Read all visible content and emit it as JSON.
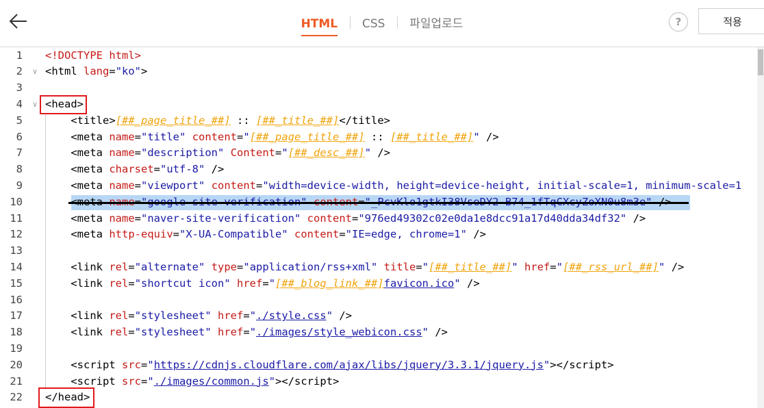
{
  "header": {
    "tabs": [
      "HTML",
      "CSS",
      "파일업로드"
    ],
    "active_tab": "HTML",
    "help_label": "?",
    "apply_label": "적용"
  },
  "editor": {
    "highlighted_line": 10,
    "redacted_line": 10,
    "lines": [
      {
        "n": "1",
        "fold": false,
        "tokens": [
          [
            "doctype",
            "<!DOCTYPE html>"
          ]
        ]
      },
      {
        "n": "2",
        "fold": true,
        "tokens": [
          [
            "punct",
            "<"
          ],
          [
            "tagname",
            "html"
          ],
          [
            "punct",
            " "
          ],
          [
            "attr",
            "lang"
          ],
          [
            "punct",
            "="
          ],
          [
            "str",
            "\"ko\""
          ],
          [
            "punct",
            ">"
          ]
        ]
      },
      {
        "n": "3",
        "fold": false,
        "tokens": []
      },
      {
        "n": "4",
        "fold": true,
        "tokens": [
          [
            "punct",
            "<"
          ],
          [
            "tagname",
            "head"
          ],
          [
            "punct",
            ">"
          ]
        ]
      },
      {
        "n": "5",
        "fold": false,
        "tokens": [
          [
            "punct",
            "    <"
          ],
          [
            "tagname",
            "title"
          ],
          [
            "punct",
            ">"
          ],
          [
            "tpl",
            "[##_page_title_##]"
          ],
          [
            "punct",
            " :: "
          ],
          [
            "tpl",
            "[##_title_##]"
          ],
          [
            "punct",
            "</"
          ],
          [
            "tagname",
            "title"
          ],
          [
            "punct",
            ">"
          ]
        ]
      },
      {
        "n": "6",
        "fold": false,
        "tokens": [
          [
            "punct",
            "    <"
          ],
          [
            "tagname",
            "meta"
          ],
          [
            "punct",
            " "
          ],
          [
            "attr",
            "name"
          ],
          [
            "punct",
            "="
          ],
          [
            "str",
            "\"title\""
          ],
          [
            "punct",
            " "
          ],
          [
            "attr",
            "content"
          ],
          [
            "punct",
            "="
          ],
          [
            "str",
            "\""
          ],
          [
            "tpl",
            "[##_page_title_##]"
          ],
          [
            "punct",
            " :: "
          ],
          [
            "tpl",
            "[##_title_##]"
          ],
          [
            "str",
            "\""
          ],
          [
            "punct",
            " />"
          ]
        ]
      },
      {
        "n": "7",
        "fold": false,
        "tokens": [
          [
            "punct",
            "    <"
          ],
          [
            "tagname",
            "meta"
          ],
          [
            "punct",
            " "
          ],
          [
            "attr",
            "name"
          ],
          [
            "punct",
            "="
          ],
          [
            "str",
            "\"description\""
          ],
          [
            "punct",
            " "
          ],
          [
            "attr",
            "Content"
          ],
          [
            "punct",
            "="
          ],
          [
            "str",
            "\""
          ],
          [
            "tpl",
            "[##_desc_##]"
          ],
          [
            "str",
            "\""
          ],
          [
            "punct",
            " />"
          ]
        ]
      },
      {
        "n": "8",
        "fold": false,
        "tokens": [
          [
            "punct",
            "    <"
          ],
          [
            "tagname",
            "meta"
          ],
          [
            "punct",
            " "
          ],
          [
            "attr",
            "charset"
          ],
          [
            "punct",
            "="
          ],
          [
            "str",
            "\"utf-8\""
          ],
          [
            "punct",
            " />"
          ]
        ]
      },
      {
        "n": "9",
        "fold": false,
        "tokens": [
          [
            "punct",
            "    <"
          ],
          [
            "tagname",
            "meta"
          ],
          [
            "punct",
            " "
          ],
          [
            "attr",
            "name"
          ],
          [
            "punct",
            "="
          ],
          [
            "str",
            "\"viewport\""
          ],
          [
            "punct",
            " "
          ],
          [
            "attr",
            "content"
          ],
          [
            "punct",
            "="
          ],
          [
            "str",
            "\"width=device-width, height=device-height, initial-scale=1, minimum-scale=1"
          ]
        ]
      },
      {
        "n": "10",
        "fold": false,
        "tokens": [
          [
            "punct",
            "    <"
          ],
          [
            "tagname",
            "meta"
          ],
          [
            "punct",
            " "
          ],
          [
            "attr",
            "name"
          ],
          [
            "punct",
            "="
          ],
          [
            "str",
            "\"google-site-verification\""
          ],
          [
            "punct",
            " "
          ],
          [
            "attr",
            "content"
          ],
          [
            "punct",
            "="
          ],
          [
            "str",
            "\"_PcvKlo1gtkI38VseDY2-B74_1fTqCXcyZoXN0u8m3e\""
          ],
          [
            "punct",
            " />"
          ]
        ]
      },
      {
        "n": "11",
        "fold": false,
        "tokens": [
          [
            "punct",
            "    <"
          ],
          [
            "tagname",
            "meta"
          ],
          [
            "punct",
            " "
          ],
          [
            "attr",
            "name"
          ],
          [
            "punct",
            "="
          ],
          [
            "str",
            "\"naver-site-verification\""
          ],
          [
            "punct",
            " "
          ],
          [
            "attr",
            "content"
          ],
          [
            "punct",
            "="
          ],
          [
            "str",
            "\"976ed49302c02e0da1e8dcc91a17d40dda34df32\""
          ],
          [
            "punct",
            " />"
          ]
        ]
      },
      {
        "n": "12",
        "fold": false,
        "tokens": [
          [
            "punct",
            "    <"
          ],
          [
            "tagname",
            "meta"
          ],
          [
            "punct",
            " "
          ],
          [
            "attr",
            "http-equiv"
          ],
          [
            "punct",
            "="
          ],
          [
            "str",
            "\"X-UA-Compatible\""
          ],
          [
            "punct",
            " "
          ],
          [
            "attr",
            "content"
          ],
          [
            "punct",
            "="
          ],
          [
            "str",
            "\"IE=edge, chrome=1\""
          ],
          [
            "punct",
            " />"
          ]
        ]
      },
      {
        "n": "13",
        "fold": false,
        "tokens": []
      },
      {
        "n": "14",
        "fold": false,
        "tokens": [
          [
            "punct",
            "    <"
          ],
          [
            "tagname",
            "link"
          ],
          [
            "punct",
            " "
          ],
          [
            "attr",
            "rel"
          ],
          [
            "punct",
            "="
          ],
          [
            "str",
            "\"alternate\""
          ],
          [
            "punct",
            " "
          ],
          [
            "attr",
            "type"
          ],
          [
            "punct",
            "="
          ],
          [
            "str",
            "\"application/rss+xml\""
          ],
          [
            "punct",
            " "
          ],
          [
            "attr",
            "title"
          ],
          [
            "punct",
            "="
          ],
          [
            "str",
            "\""
          ],
          [
            "tpl",
            "[##_title_##]"
          ],
          [
            "str",
            "\""
          ],
          [
            "punct",
            " "
          ],
          [
            "attr",
            "href"
          ],
          [
            "punct",
            "="
          ],
          [
            "str",
            "\""
          ],
          [
            "tpl",
            "[##_rss_url_##]"
          ],
          [
            "str",
            "\""
          ],
          [
            "punct",
            " />"
          ]
        ]
      },
      {
        "n": "15",
        "fold": false,
        "tokens": [
          [
            "punct",
            "    <"
          ],
          [
            "tagname",
            "link"
          ],
          [
            "punct",
            " "
          ],
          [
            "attr",
            "rel"
          ],
          [
            "punct",
            "="
          ],
          [
            "str",
            "\"shortcut icon\""
          ],
          [
            "punct",
            " "
          ],
          [
            "attr",
            "href"
          ],
          [
            "punct",
            "="
          ],
          [
            "str",
            "\""
          ],
          [
            "tpl",
            "[##_blog_link_##]"
          ],
          [
            "link",
            "favicon.ico"
          ],
          [
            "str",
            "\""
          ],
          [
            "punct",
            " />"
          ]
        ]
      },
      {
        "n": "16",
        "fold": false,
        "tokens": []
      },
      {
        "n": "17",
        "fold": false,
        "tokens": [
          [
            "punct",
            "    <"
          ],
          [
            "tagname",
            "link"
          ],
          [
            "punct",
            " "
          ],
          [
            "attr",
            "rel"
          ],
          [
            "punct",
            "="
          ],
          [
            "str",
            "\"stylesheet\""
          ],
          [
            "punct",
            " "
          ],
          [
            "attr",
            "href"
          ],
          [
            "punct",
            "="
          ],
          [
            "str",
            "\""
          ],
          [
            "link",
            "./style.css"
          ],
          [
            "str",
            "\""
          ],
          [
            "punct",
            " />"
          ]
        ]
      },
      {
        "n": "18",
        "fold": false,
        "tokens": [
          [
            "punct",
            "    <"
          ],
          [
            "tagname",
            "link"
          ],
          [
            "punct",
            " "
          ],
          [
            "attr",
            "rel"
          ],
          [
            "punct",
            "="
          ],
          [
            "str",
            "\"stylesheet\""
          ],
          [
            "punct",
            " "
          ],
          [
            "attr",
            "href"
          ],
          [
            "punct",
            "="
          ],
          [
            "str",
            "\""
          ],
          [
            "link",
            "./images/style_webicon.css"
          ],
          [
            "str",
            "\""
          ],
          [
            "punct",
            " />"
          ]
        ]
      },
      {
        "n": "19",
        "fold": false,
        "tokens": []
      },
      {
        "n": "20",
        "fold": false,
        "tokens": [
          [
            "punct",
            "    <"
          ],
          [
            "tagname",
            "script"
          ],
          [
            "punct",
            " "
          ],
          [
            "attr",
            "src"
          ],
          [
            "punct",
            "="
          ],
          [
            "str",
            "\""
          ],
          [
            "link",
            "https://cdnjs.cloudflare.com/ajax/libs/jquery/3.3.1/jquery.js"
          ],
          [
            "str",
            "\""
          ],
          [
            "punct",
            "></"
          ],
          [
            "tagname",
            "script"
          ],
          [
            "punct",
            ">"
          ]
        ]
      },
      {
        "n": "21",
        "fold": false,
        "tokens": [
          [
            "punct",
            "    <"
          ],
          [
            "tagname",
            "script"
          ],
          [
            "punct",
            " "
          ],
          [
            "attr",
            "src"
          ],
          [
            "punct",
            "="
          ],
          [
            "str",
            "\""
          ],
          [
            "link",
            "./images/common.js"
          ],
          [
            "str",
            "\""
          ],
          [
            "punct",
            "></"
          ],
          [
            "tagname",
            "script"
          ],
          [
            "punct",
            ">"
          ]
        ]
      },
      {
        "n": "22",
        "fold": false,
        "tokens": [
          [
            "punct",
            "</"
          ],
          [
            "tagname",
            "head"
          ],
          [
            "punct",
            ">"
          ]
        ]
      }
    ]
  },
  "colors": {
    "accent": "#ee5a24",
    "annotation_red": "#e0181b",
    "selection": "#b8d7f5",
    "string": "#1a1aa6",
    "attribute": "#c41a16",
    "template": "#f0a30a"
  }
}
